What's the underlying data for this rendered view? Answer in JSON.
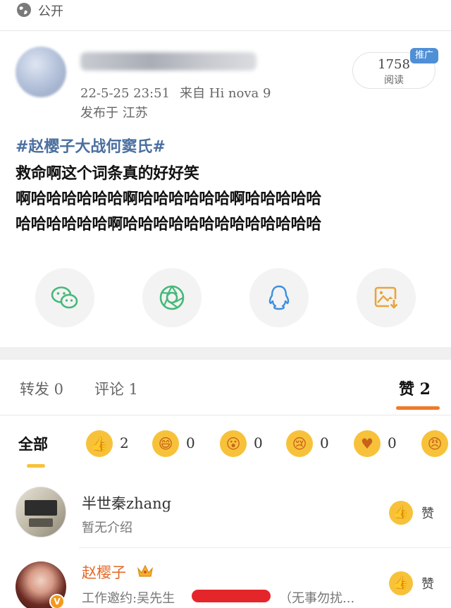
{
  "topbar": {
    "visibility_label": "公开",
    "icon": "globe-icon"
  },
  "post": {
    "datetime": "22-5-25 23:51",
    "source": "来自 Hi nova 9",
    "location": "发布于 江苏",
    "reads_count": "1758",
    "reads_label": "阅读",
    "promo_badge": "推广",
    "hashtag": "#赵樱子大战何窦氏#",
    "text_lines": [
      "救命啊这个词条真的好好笑",
      "啊哈哈哈哈哈哈啊哈哈哈哈哈哈啊哈哈哈哈哈",
      "哈哈哈哈哈哈啊哈哈哈哈哈哈哈哈哈哈哈哈哈"
    ]
  },
  "share": [
    {
      "icon": "wechat-icon"
    },
    {
      "icon": "moments-icon"
    },
    {
      "icon": "qq-icon"
    },
    {
      "icon": "save-image-icon"
    }
  ],
  "tabs": {
    "repost": "转发 0",
    "comment": "评论 1",
    "like": "赞 2"
  },
  "reactions": {
    "all_label": "全部",
    "items": [
      {
        "icon": "thumbs-up-emoji-icon",
        "count": "2"
      },
      {
        "icon": "laughing-emoji-icon",
        "count": "0"
      },
      {
        "icon": "surprised-emoji-icon",
        "count": "0"
      },
      {
        "icon": "crying-emoji-icon",
        "count": "0"
      },
      {
        "icon": "heart-emoji-icon",
        "count": "0"
      },
      {
        "icon": "angry-emoji-icon"
      }
    ]
  },
  "likers": [
    {
      "name": "半世秦zhang",
      "bio": "暂无介绍",
      "like_label": "赞"
    },
    {
      "name": "赵樱子",
      "bio_prefix": "工作邀约:吴先生",
      "bio_suffix": "（无事勿扰...",
      "like_label": "赞",
      "verified_badge": "V"
    }
  ],
  "colors": {
    "accent_orange": "#f07a2a",
    "emoji_yellow": "#f7c23a",
    "hashtag_blue": "#4b6fa0",
    "promo_blue": "#4f8fd6"
  }
}
